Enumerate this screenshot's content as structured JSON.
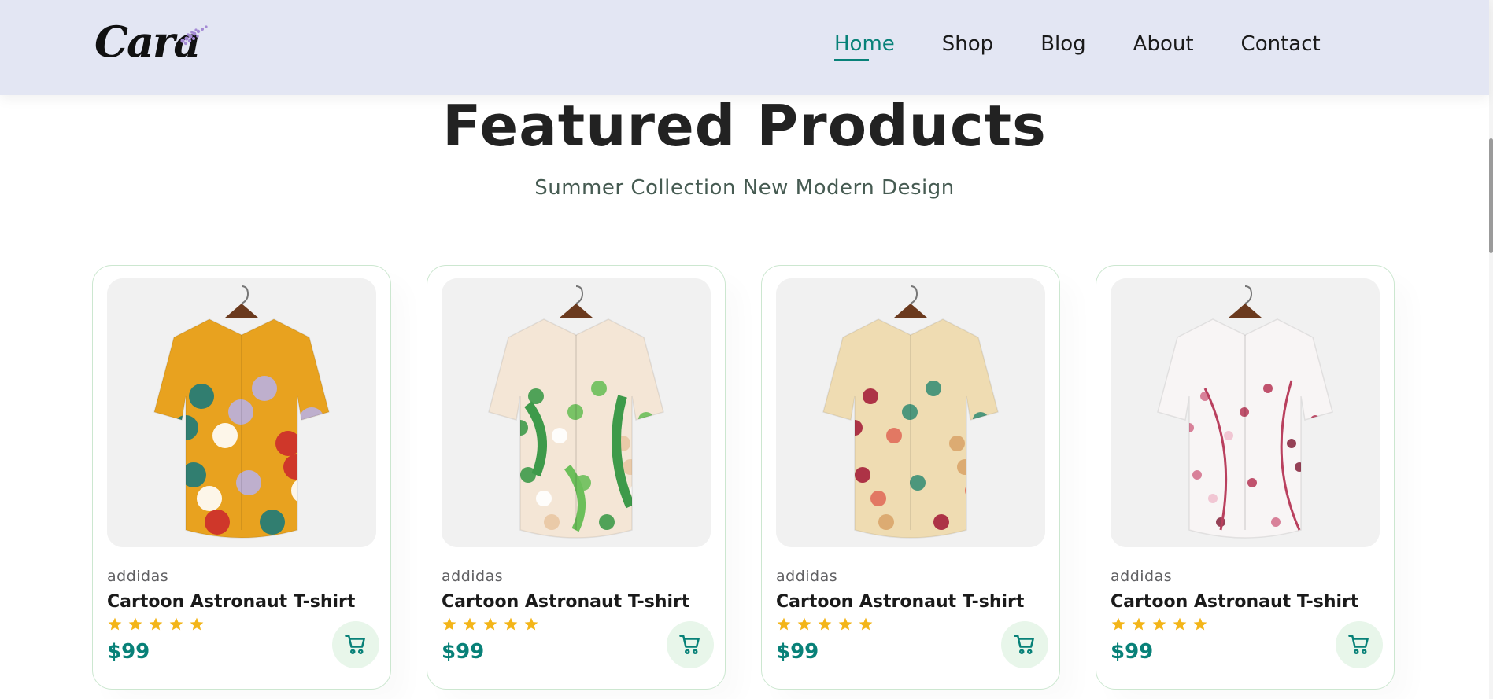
{
  "header": {
    "logo_text": "Cara",
    "nav": [
      {
        "label": "Home",
        "active": true
      },
      {
        "label": "Shop",
        "active": false
      },
      {
        "label": "Blog",
        "active": false
      },
      {
        "label": "About",
        "active": false
      },
      {
        "label": "Contact",
        "active": false
      }
    ]
  },
  "section": {
    "title": "Featured Products",
    "subtitle": "Summer Collection New Modern Design"
  },
  "products": [
    {
      "brand": "addidas",
      "name": "Cartoon Astronaut T-shirt",
      "rating": 5,
      "price": "$99",
      "image_icon": "shirt-image-colorful-abstract"
    },
    {
      "brand": "addidas",
      "name": "Cartoon Astronaut T-shirt",
      "rating": 5,
      "price": "$99",
      "image_icon": "shirt-image-green-floral"
    },
    {
      "brand": "addidas",
      "name": "Cartoon Astronaut T-shirt",
      "rating": 5,
      "price": "$99",
      "image_icon": "shirt-image-red-rose"
    },
    {
      "brand": "addidas",
      "name": "Cartoon Astronaut T-shirt",
      "rating": 5,
      "price": "$99",
      "image_icon": "shirt-image-pink-blossom"
    }
  ],
  "colors": {
    "accent": "#088178",
    "header_bg": "#e3e6f3",
    "star": "#f3b519",
    "card_border": "#cce7d0",
    "cart_bg": "#e8f6ea"
  }
}
